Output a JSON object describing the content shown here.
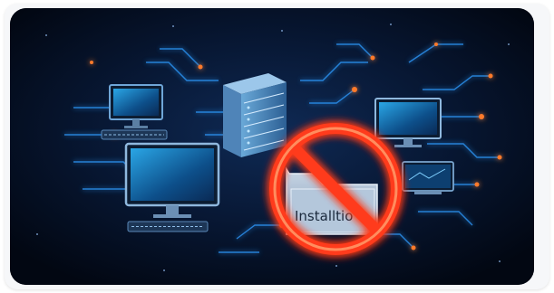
{
  "image": {
    "folder_label": "Installtio",
    "colors": {
      "background": "#040b19",
      "circuit_blue": "#2f9bff",
      "glow_orange": "#ff7a2a",
      "prohibition_red": "#ff3b1a"
    },
    "icons": [
      "monitor-icon",
      "server-rack-icon",
      "keyboard-icon",
      "folder-icon",
      "prohibition-icon"
    ]
  }
}
